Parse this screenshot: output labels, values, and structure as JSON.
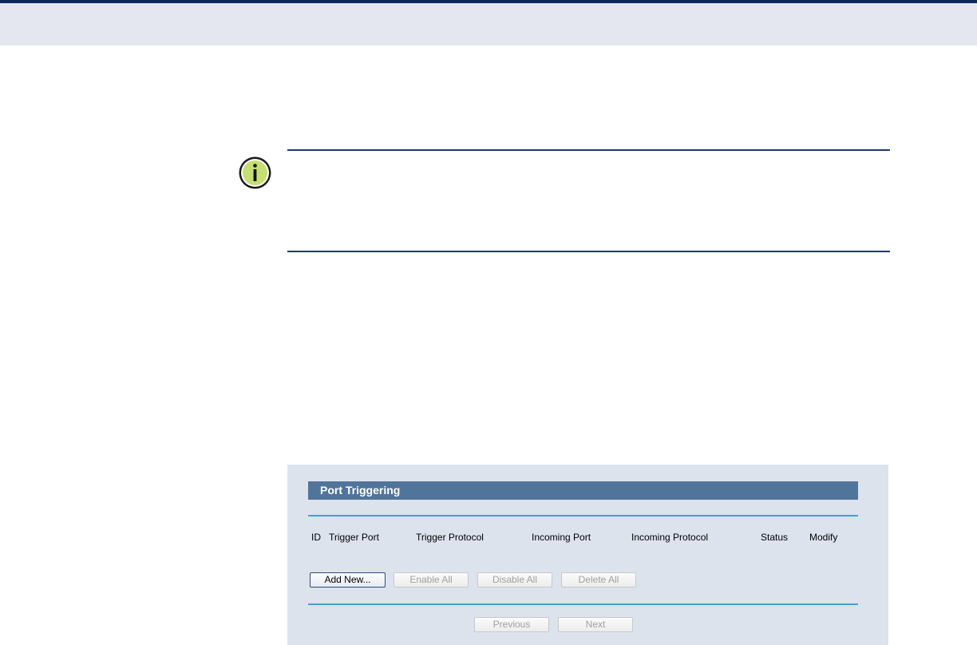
{
  "panel": {
    "title": "Port Triggering",
    "columns": [
      "ID",
      "Trigger Port",
      "Trigger Protocol",
      "Incoming Port",
      "Incoming Protocol",
      "Status",
      "Modify"
    ],
    "actions": {
      "add_new": "Add New...",
      "enable_all": "Enable All",
      "disable_all": "Disable All",
      "delete_all": "Delete All"
    },
    "pagination": {
      "previous": "Previous",
      "next": "Next"
    }
  },
  "colors": {
    "title_bar": "#51749b",
    "panel_background": "#dde3ed",
    "panel_rule": "#3fa3d6",
    "note_rule": "#1b3a70",
    "note_icon_fill": "#c6e06f"
  },
  "note_icon": "info-icon"
}
